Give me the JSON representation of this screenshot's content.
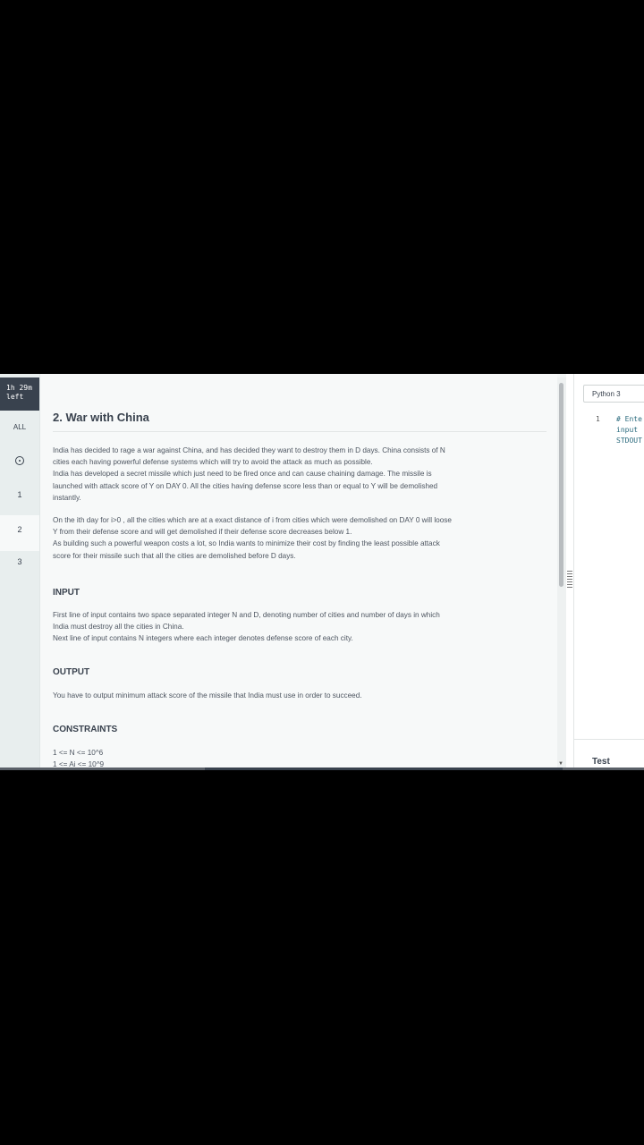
{
  "timer": {
    "line1": "1h 29m",
    "line2": "left"
  },
  "nav": {
    "all": "ALL",
    "items": [
      "1",
      "2",
      "3"
    ]
  },
  "problem": {
    "title": "2. War with China",
    "para1": [
      "India has decided to rage a war against China, and has decided they want to destroy them in D days. China consists of N",
      "cities each having powerful defense systems which will try to avoid the attack as much as possible.",
      "India has developed a secret missile which just need to be fired once and can cause chaining damage. The missile is",
      "launched with attack score of Y on DAY 0. All the cities having defense score less than or equal to Y will be demolished",
      "instantly."
    ],
    "para2": [
      "On the ith day for i>0 , all the cities which are at a exact distance of i from cities which were demolished on DAY 0 will loose",
      "Y from their defense score and will get demolished if their defense score decreases below 1.",
      "As building such a powerful weapon costs a lot, so India wants to minimize their cost by finding the least possible attack",
      "score for their missile such that all the cities are demolished before D days."
    ],
    "input_heading": "INPUT",
    "input": [
      "First line of input contains two space separated integer N and D, denoting number of cities and number of days in which",
      "India must destroy all the cities in China.",
      "Next line of input contains N integers where each integer denotes defense score of each city."
    ],
    "output_heading": "OUTPUT",
    "output": [
      "You have to output minimum attack score of the missile that India must use in order to succeed."
    ],
    "constraints_heading": "CONSTRAINTS",
    "constraints": [
      "1 <= N <= 10^6",
      "1 <= Ai <= 10^9"
    ]
  },
  "editor": {
    "language": "Python 3",
    "line_number": "1",
    "code": [
      "# Ente",
      "input",
      "STDOUT"
    ],
    "test_label": "Test"
  }
}
